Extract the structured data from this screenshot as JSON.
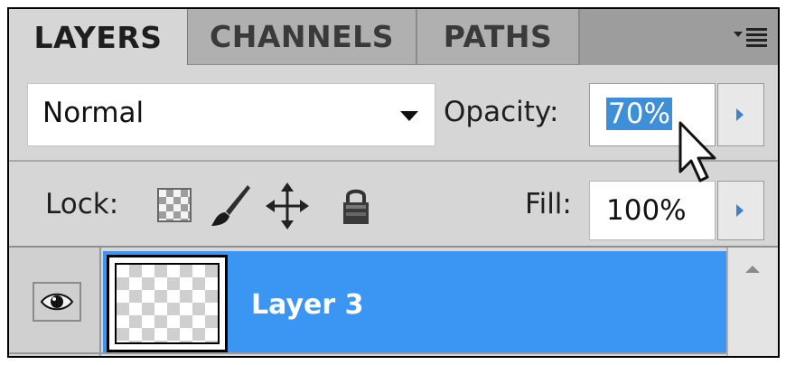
{
  "tabs": [
    {
      "label": "LAYERS",
      "active": true
    },
    {
      "label": "CHANNELS",
      "active": false
    },
    {
      "label": "PATHS",
      "active": false
    }
  ],
  "panel_menu_icon": "panel-menu-icon",
  "blend_mode": {
    "value": "Normal"
  },
  "opacity": {
    "label": "Opacity:",
    "value": "70%"
  },
  "lock": {
    "label": "Lock:",
    "icons": [
      "lock-transparent-pixels-icon",
      "lock-image-pixels-icon",
      "lock-position-icon",
      "lock-all-icon"
    ]
  },
  "fill": {
    "label": "Fill:",
    "value": "100%"
  },
  "layers": [
    {
      "name": "Layer 3",
      "visible": true,
      "selected": true
    }
  ],
  "colors": {
    "selection": "#3b96f3",
    "text_selection": "#3e8ed8",
    "panel_bg": "#d6d6d6",
    "tab_bar": "#9d9d9d"
  }
}
